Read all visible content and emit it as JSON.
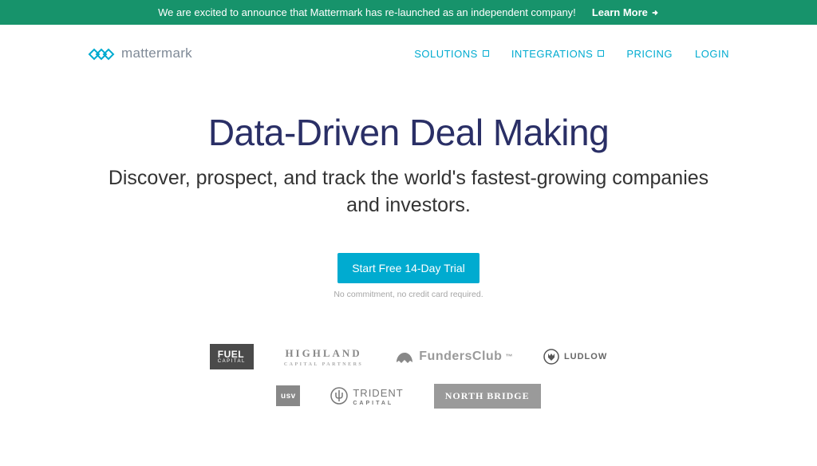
{
  "announcement": {
    "text": "We are excited to announce that Mattermark has re-launched as an independent company!",
    "cta": "Learn More"
  },
  "brand": {
    "name": "mattermark"
  },
  "nav": {
    "solutions": "SOLUTIONS",
    "integrations": "INTEGRATIONS",
    "pricing": "PRICING",
    "login": "LOGIN"
  },
  "hero": {
    "title": "Data-Driven Deal Making",
    "subtitle": "Discover, prospect, and track the world's fastest-growing companies and investors."
  },
  "cta": {
    "button": "Start Free 14-Day Trial",
    "note": "No commitment, no credit card required."
  },
  "partners": {
    "row1": {
      "fuel": "FUEL",
      "fuel_sub": "CAPITAL",
      "highland": "HIGHLAND",
      "highland_sub": "CAPITAL PARTNERS",
      "fundersclub": "FundersClub",
      "ludlow": "LUDLOW"
    },
    "row2": {
      "usv": "usv",
      "trident": "TRIDENT",
      "trident_sub": "CAPITAL",
      "northbridge": "NORTH BRIDGE"
    }
  }
}
